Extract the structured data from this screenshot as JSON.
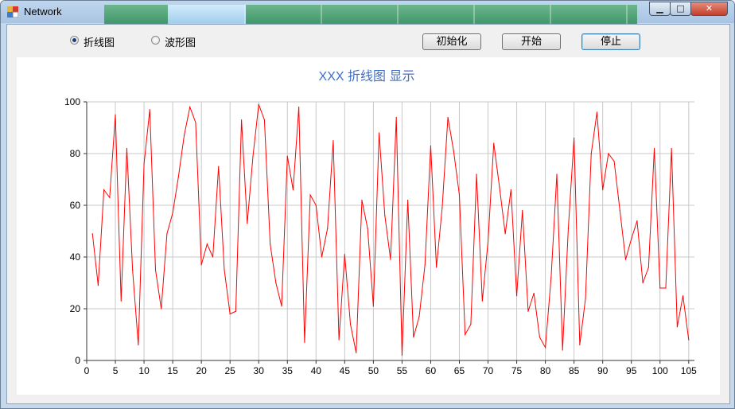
{
  "window": {
    "title": "Network"
  },
  "controls": {
    "radio_line": "折线图",
    "radio_wave": "波形图",
    "init_label": "初始化",
    "start_label": "开始",
    "stop_label": "停止"
  },
  "chart_data": {
    "type": "line",
    "title": "XXX 折线图 显示",
    "xlabel": "",
    "ylabel": "",
    "xlim": [
      0,
      106
    ],
    "ylim": [
      0,
      100
    ],
    "xticks": [
      0,
      5,
      10,
      15,
      20,
      25,
      30,
      35,
      40,
      45,
      50,
      55,
      60,
      65,
      70,
      75,
      80,
      85,
      90,
      95,
      100,
      105
    ],
    "yticks": [
      0,
      20,
      40,
      60,
      80,
      100
    ],
    "grid": true,
    "color": "#ff0000",
    "series": [
      {
        "x": [
          1,
          2,
          3,
          4,
          5,
          6,
          7,
          8,
          9,
          10,
          11,
          12,
          13,
          14,
          15,
          16,
          17,
          18,
          19,
          20,
          21,
          22,
          23,
          24,
          25,
          26,
          27,
          28,
          29,
          30,
          31,
          32,
          33,
          34,
          35,
          36,
          37,
          38,
          39,
          40,
          41,
          42,
          43,
          44,
          45,
          46,
          47,
          48,
          49,
          50,
          51,
          52,
          53,
          54,
          55,
          56,
          57,
          58,
          59,
          60,
          61,
          62,
          63,
          64,
          65,
          66,
          67,
          68,
          69,
          70,
          71,
          72,
          73,
          74,
          75,
          76,
          77,
          78,
          79,
          80,
          81,
          82,
          83,
          84,
          85,
          86,
          87,
          88,
          89,
          90,
          91,
          92,
          93,
          94,
          95,
          96,
          97,
          98,
          99,
          100,
          101,
          102,
          103,
          104,
          105
        ],
        "values": [
          49,
          29,
          66,
          63,
          95,
          23,
          82,
          35,
          6,
          76,
          97,
          35,
          20,
          49,
          57,
          71,
          87,
          98,
          92,
          37,
          45,
          40,
          75,
          35,
          18,
          19,
          93,
          53,
          79,
          99,
          93,
          45,
          30,
          21,
          79,
          66,
          98,
          7,
          64,
          60,
          40,
          51,
          85,
          8,
          41,
          14,
          3,
          62,
          51,
          21,
          88,
          56,
          39,
          94,
          2,
          62,
          9,
          17,
          37,
          83,
          36,
          59,
          94,
          81,
          64,
          10,
          14,
          72,
          23,
          46,
          84,
          67,
          49,
          66,
          25,
          58,
          19,
          26,
          9,
          5,
          32,
          72,
          4,
          51,
          86,
          6,
          24,
          80,
          96,
          66,
          80,
          77,
          58,
          39,
          47,
          54,
          30,
          36,
          82,
          28,
          28,
          82,
          13,
          25,
          8
        ]
      }
    ]
  }
}
